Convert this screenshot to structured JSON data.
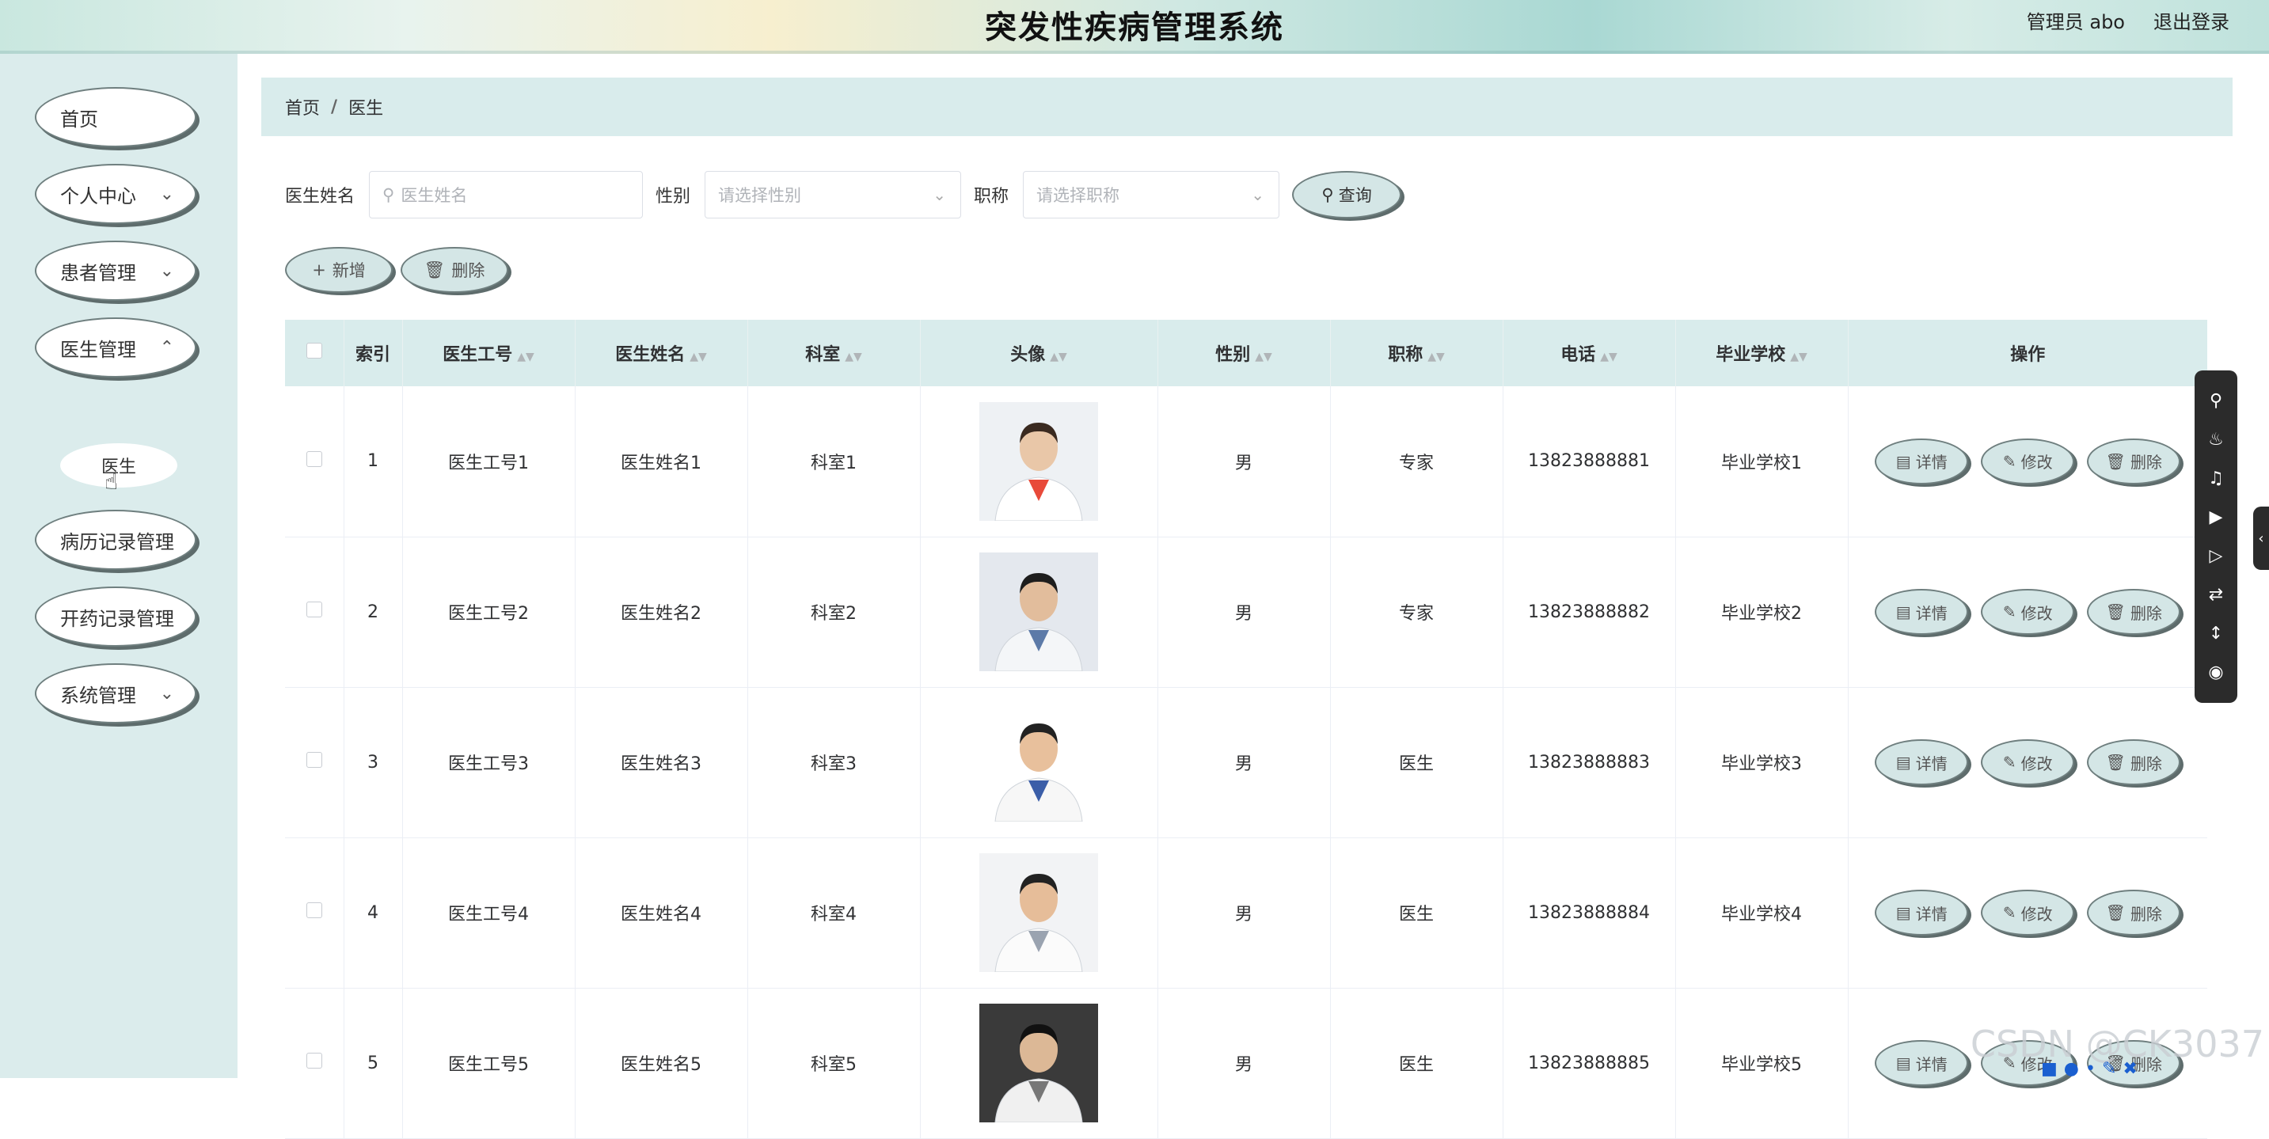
{
  "header": {
    "title": "突发性疾病管理系统",
    "user_label": "管理员 abo",
    "logout_label": "退出登录"
  },
  "sidebar": {
    "items": [
      {
        "label": "首页",
        "has_chevron": false
      },
      {
        "label": "个人中心",
        "has_chevron": true
      },
      {
        "label": "患者管理",
        "has_chevron": true
      },
      {
        "label": "医生管理",
        "has_chevron": true
      },
      {
        "label": "病历记录管理",
        "has_chevron": false
      },
      {
        "label": "开药记录管理",
        "has_chevron": false
      },
      {
        "label": "系统管理",
        "has_chevron": true
      }
    ],
    "sub_item": "医生"
  },
  "breadcrumb": {
    "home": "首页",
    "sep": "/",
    "current": "医生"
  },
  "search": {
    "name_label": "医生姓名",
    "name_placeholder": "医生姓名",
    "gender_label": "性别",
    "gender_placeholder": "请选择性别",
    "title_label": "职称",
    "title_placeholder": "请选择职称",
    "query_label": "查询"
  },
  "actions": {
    "add_label": "新增",
    "delete_label": "删除"
  },
  "table": {
    "columns": [
      "索引",
      "医生工号",
      "医生姓名",
      "科室",
      "头像",
      "性别",
      "职称",
      "电话",
      "毕业学校",
      "操作"
    ],
    "rows": [
      {
        "index": "1",
        "id": "医生工号1",
        "name": "医生姓名1",
        "dept": "科室1",
        "gender": "男",
        "title": "专家",
        "phone": "13823888881",
        "school": "毕业学校1"
      },
      {
        "index": "2",
        "id": "医生工号2",
        "name": "医生姓名2",
        "dept": "科室2",
        "gender": "男",
        "title": "专家",
        "phone": "13823888882",
        "school": "毕业学校2"
      },
      {
        "index": "3",
        "id": "医生工号3",
        "name": "医生姓名3",
        "dept": "科室3",
        "gender": "男",
        "title": "医生",
        "phone": "13823888883",
        "school": "毕业学校3"
      },
      {
        "index": "4",
        "id": "医生工号4",
        "name": "医生姓名4",
        "dept": "科室4",
        "gender": "男",
        "title": "医生",
        "phone": "13823888884",
        "school": "毕业学校4"
      },
      {
        "index": "5",
        "id": "医生工号5",
        "name": "医生姓名5",
        "dept": "科室5",
        "gender": "男",
        "title": "医生",
        "phone": "13823888885",
        "school": "毕业学校5"
      }
    ],
    "op_labels": {
      "detail": "详情",
      "edit": "修改",
      "delete": "删除"
    }
  },
  "watermark": "CSDN @CK3037",
  "colors": {
    "accent_bg": "#d9ecec",
    "sidebar_bg": "#dbecec",
    "pill_border": "#6f7f7f"
  }
}
